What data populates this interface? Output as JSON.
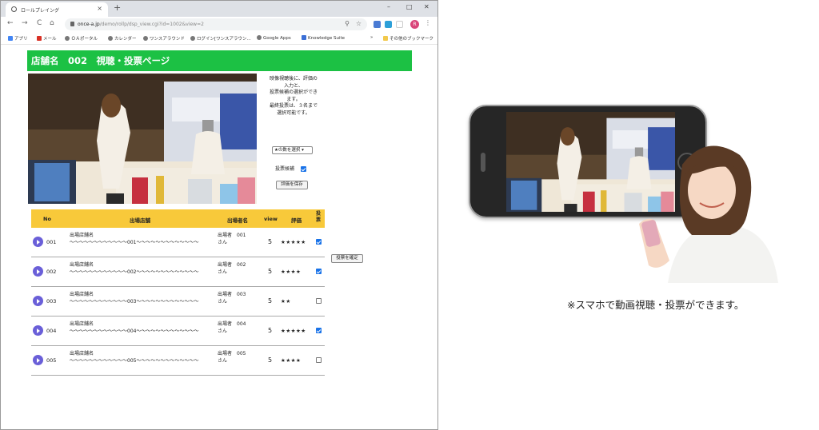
{
  "browser": {
    "tab_title": "ロールプレイング",
    "tab_close": "×",
    "new_tab": "+",
    "window_controls": {
      "minimize": "–",
      "maximize": "□",
      "close": "✕"
    },
    "nav": {
      "back": "←",
      "forward": "→",
      "reload": "C",
      "home": "⌂"
    },
    "url_host": "once-a.jp",
    "url_path": "/demo/rollp/dsp_view.cgi?id=1002&view=2",
    "profile_initial": "R",
    "bookmarks": [
      "アプリ",
      "メール",
      "ＯＡポータル",
      "カレンダー",
      "ワンスアラウンド",
      "ログイン[ワンスアラウン...",
      "Google Apps",
      "Knowledge Suite"
    ],
    "bookmarks_overflow": "»",
    "other_bookmarks": "その他のブックマーク"
  },
  "page": {
    "header": "店舗名　002　視聴・投票ページ",
    "info_lines": [
      "映像視聴後に、評価の",
      "入力と、",
      "投票候補の選択ができ",
      "ます。",
      "最終投票は、３名まで",
      "選択可能です。"
    ],
    "rating_select_value": "★の数を選択",
    "candidate_label": "投票候補",
    "candidate_checked": true,
    "save_button": "評価を保存",
    "confirm_button": "投票を確定",
    "table": {
      "headers": {
        "no": "No",
        "shop": "出場店舗",
        "performer": "出場者名",
        "view": "view",
        "rating": "評価",
        "vote": "投票"
      },
      "rows": [
        {
          "no": "001",
          "shop_line1": "出場店舗名",
          "shop_line2": "〜〜〜〜〜〜〜〜〜〜〜〜001〜〜〜〜〜〜〜〜〜〜〜〜〜",
          "performer_line1": "出場者　001",
          "performer_line2": "さん",
          "view": "5",
          "stars": "★★★★★",
          "voted": true
        },
        {
          "no": "002",
          "shop_line1": "出場店舗名",
          "shop_line2": "〜〜〜〜〜〜〜〜〜〜〜〜002〜〜〜〜〜〜〜〜〜〜〜〜〜",
          "performer_line1": "出場者　002",
          "performer_line2": "さん",
          "view": "5",
          "stars": "★★★★",
          "voted": true
        },
        {
          "no": "003",
          "shop_line1": "出場店舗名",
          "shop_line2": "〜〜〜〜〜〜〜〜〜〜〜〜003〜〜〜〜〜〜〜〜〜〜〜〜〜",
          "performer_line1": "出場者　003",
          "performer_line2": "さん",
          "view": "5",
          "stars": "★★",
          "voted": false
        },
        {
          "no": "004",
          "shop_line1": "出場店舗名",
          "shop_line2": "〜〜〜〜〜〜〜〜〜〜〜〜004〜〜〜〜〜〜〜〜〜〜〜〜〜",
          "performer_line1": "出場者　004",
          "performer_line2": "さん",
          "view": "5",
          "stars": "★★★★★",
          "voted": true
        },
        {
          "no": "005",
          "shop_line1": "出場店舗名",
          "shop_line2": "〜〜〜〜〜〜〜〜〜〜〜〜005〜〜〜〜〜〜〜〜〜〜〜〜〜",
          "performer_line1": "出場者　005",
          "performer_line2": "さん",
          "view": "5",
          "stars": "★★★★",
          "voted": false
        }
      ]
    }
  },
  "caption": "※スマホで動画視聴・投票ができます。",
  "colors": {
    "header_green": "#1cc144",
    "table_header_yellow": "#f8c93a",
    "play_purple": "#6a5fd8",
    "checkbox_blue": "#1a73e8"
  }
}
